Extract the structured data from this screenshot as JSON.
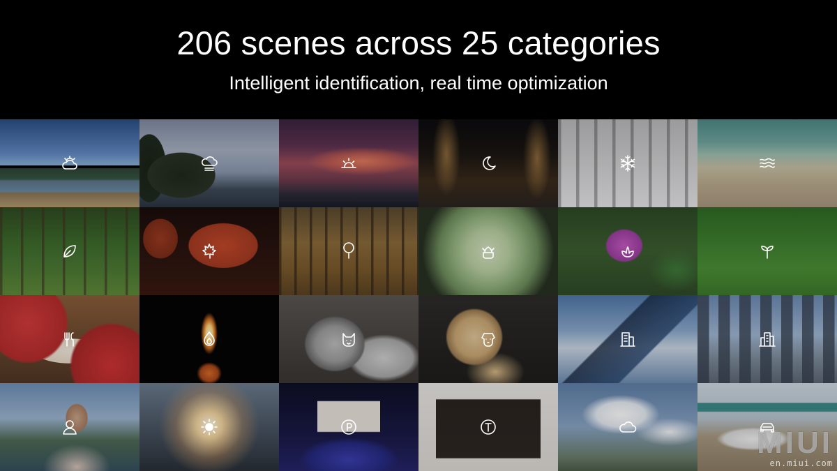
{
  "header": {
    "title": "206 scenes across 25 categories",
    "subtitle": "Intelligent identification, real time optimization"
  },
  "watermark": {
    "logo": "MIUI",
    "url": "en.miui.com"
  },
  "tiles": [
    {
      "icon": "partly-cloudy-icon",
      "scene": "blue-sky-lake"
    },
    {
      "icon": "overcast-cloud-icon",
      "scene": "overcast-trees"
    },
    {
      "icon": "sunset-icon",
      "scene": "red-sunset-clouds"
    },
    {
      "icon": "night-moon-icon",
      "scene": "night-street"
    },
    {
      "icon": "snowflake-icon",
      "scene": "snowy-forest"
    },
    {
      "icon": "waves-icon",
      "scene": "beach"
    },
    {
      "icon": "leaf-icon",
      "scene": "green-forest"
    },
    {
      "icon": "maple-leaf-icon",
      "scene": "red-maple-leaves"
    },
    {
      "icon": "tree-icon",
      "scene": "autumn-trees"
    },
    {
      "icon": "succulent-icon",
      "scene": "succulent-plant"
    },
    {
      "icon": "flower-icon",
      "scene": "purple-lotus"
    },
    {
      "icon": "sprout-icon",
      "scene": "grass-field"
    },
    {
      "icon": "food-icon",
      "scene": "desserts"
    },
    {
      "icon": "candle-icon",
      "scene": "candle-flame"
    },
    {
      "icon": "cat-icon",
      "scene": "cat"
    },
    {
      "icon": "dog-icon",
      "scene": "dog"
    },
    {
      "icon": "building-icon",
      "scene": "modern-building"
    },
    {
      "icon": "city-buildings-icon",
      "scene": "city-skyline"
    },
    {
      "icon": "portrait-icon",
      "scene": "portrait-woman"
    },
    {
      "icon": "backlight-icon",
      "scene": "backlit-portrait"
    },
    {
      "icon": "stage-icon",
      "scene": "stage-show"
    },
    {
      "icon": "text-icon",
      "scene": "signboard-text"
    },
    {
      "icon": "cloud-icon",
      "scene": "white-clouds"
    },
    {
      "icon": "car-icon",
      "scene": "white-car"
    }
  ],
  "colors": {
    "background": "#000000",
    "text": "#ffffff"
  }
}
